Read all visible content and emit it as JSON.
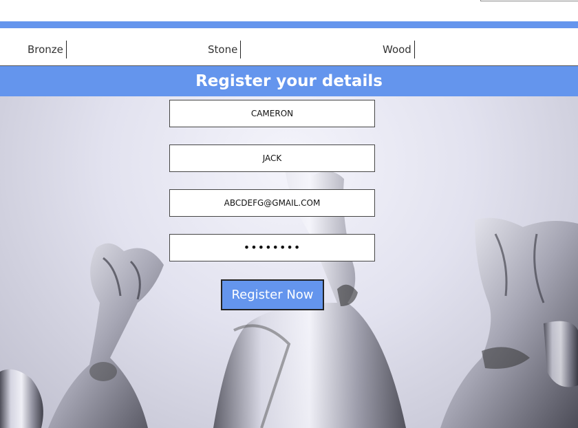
{
  "nav": {
    "items": [
      {
        "label": "Bronze"
      },
      {
        "label": "Stone"
      },
      {
        "label": "Wood"
      }
    ]
  },
  "banner": {
    "title": "Register your details"
  },
  "form": {
    "last_name": "CAMERON",
    "first_name": "JACK",
    "email": "ABCDEFG@GMAIL.COM",
    "password_masked": "••••••••",
    "submit_label": "Register Now"
  },
  "colors": {
    "accent": "#6495ed",
    "nav_text": "#333333",
    "border": "#444444"
  },
  "background_image": {
    "subject": "glass-sculptures"
  }
}
